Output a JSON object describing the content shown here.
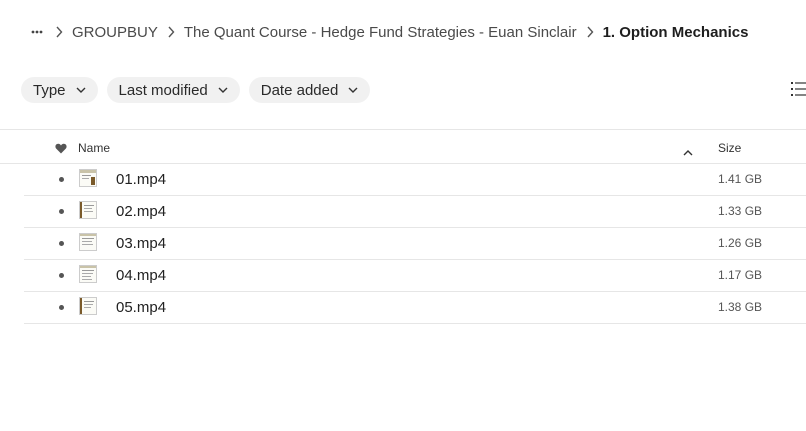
{
  "breadcrumb": {
    "more_icon": "ellipsis-icon",
    "separator_icon": "chevron-right-icon",
    "items": [
      "GROUPBUY",
      "The Quant Course - Hedge Fund Strategies - Euan Sinclair"
    ],
    "current": "1. Option Mechanics"
  },
  "filters": [
    {
      "label": "Type"
    },
    {
      "label": "Last modified"
    },
    {
      "label": "Date added"
    }
  ],
  "view_toggle_icon": "list-view-icon",
  "table": {
    "favorite_icon": "heart-icon",
    "name_header": "Name",
    "sort_icon": "sort-ascending-caret-icon",
    "size_header": "Size",
    "rows": [
      {
        "name": "01.mp4",
        "size": "1.41 GB"
      },
      {
        "name": "02.mp4",
        "size": "1.33 GB"
      },
      {
        "name": "03.mp4",
        "size": "1.26 GB"
      },
      {
        "name": "04.mp4",
        "size": "1.17 GB"
      },
      {
        "name": "05.mp4",
        "size": "1.38 GB"
      }
    ]
  },
  "colors": {
    "chip_bg": "#f1f1f1",
    "divider": "#e6e6e6",
    "text": "#1e1e1e",
    "muted": "#555555"
  }
}
